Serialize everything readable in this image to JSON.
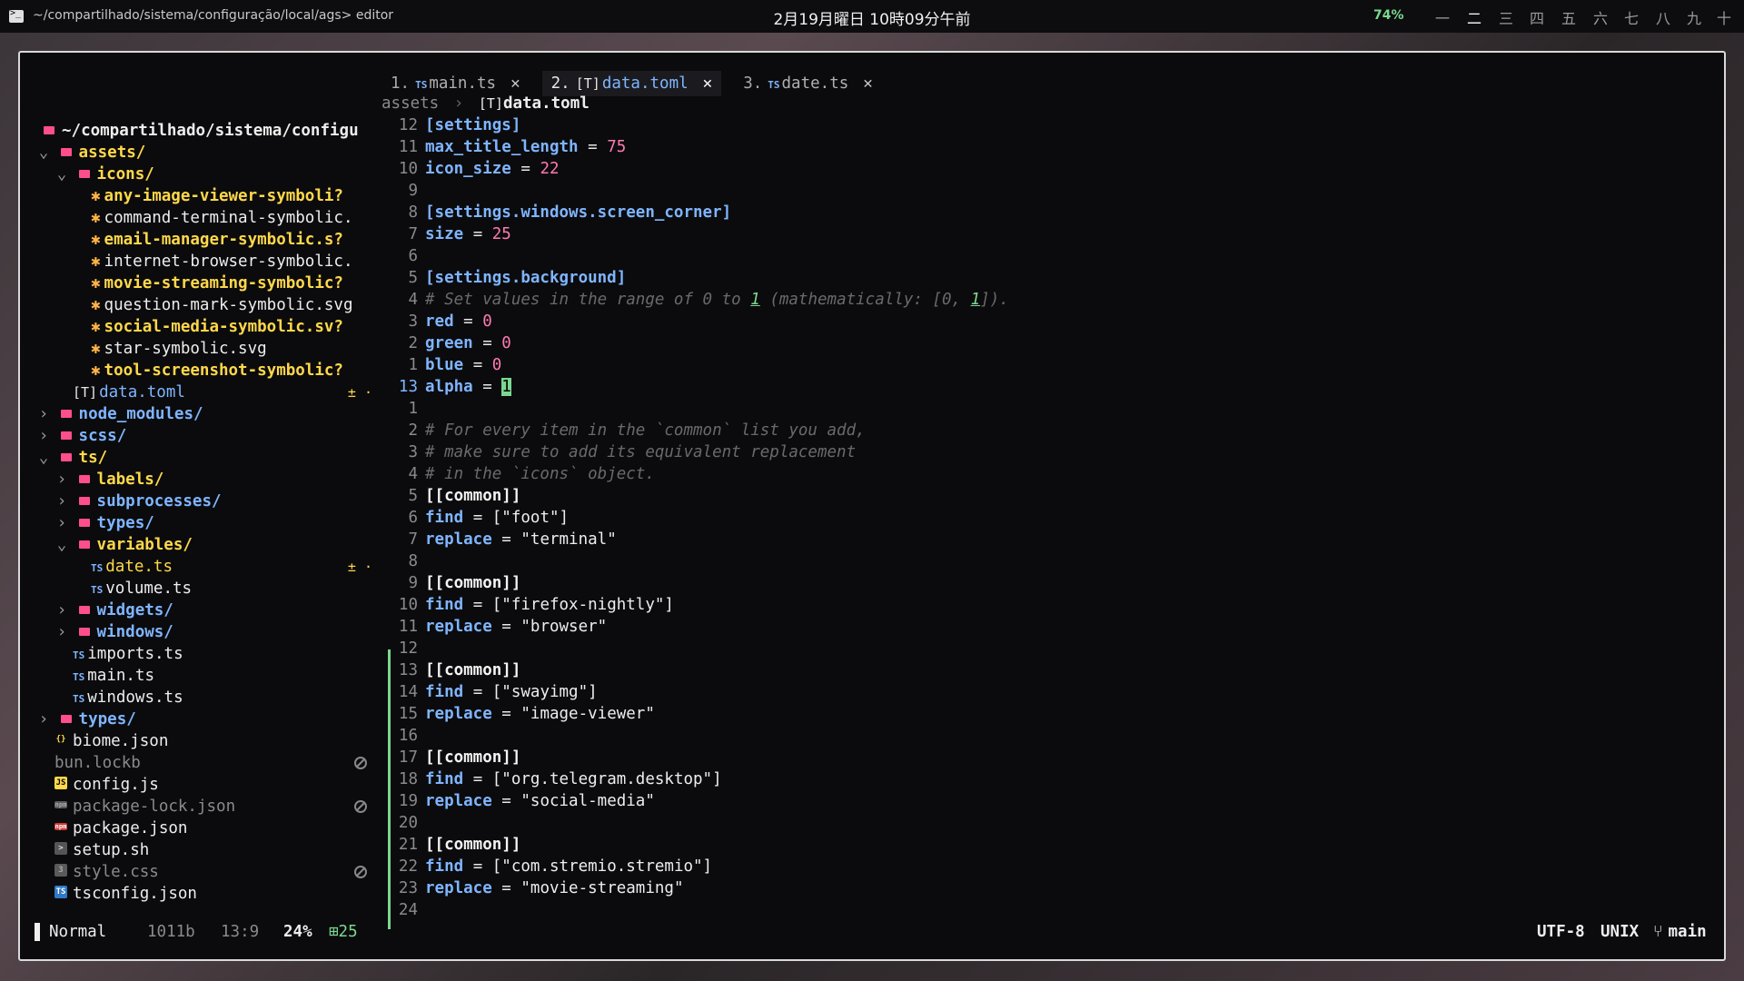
{
  "topbar": {
    "window_title": "~/compartilhado/sistema/configuração/local/ags> editor",
    "clock": "2月19月曜日 10時09分午前",
    "battery": "74%",
    "workspaces": [
      "一",
      "二",
      "三",
      "四",
      "五",
      "六",
      "七",
      "八",
      "九",
      "十"
    ]
  },
  "sidebar": {
    "root": "~/compartilhado/sistema/configu",
    "items": [
      {
        "label": "assets/",
        "kind": "dir"
      },
      {
        "label": "icons/",
        "kind": "dir"
      },
      {
        "label": "any-image-viewer-symboli?",
        "kind": "svg-mod"
      },
      {
        "label": "command-terminal-symbolic.",
        "kind": "svg"
      },
      {
        "label": "email-manager-symbolic.s?",
        "kind": "svg-mod"
      },
      {
        "label": "internet-browser-symbolic.",
        "kind": "svg"
      },
      {
        "label": "movie-streaming-symbolic?",
        "kind": "svg-mod"
      },
      {
        "label": "question-mark-symbolic.svg",
        "kind": "svg"
      },
      {
        "label": "social-media-symbolic.sv?",
        "kind": "svg-mod"
      },
      {
        "label": "star-symbolic.svg",
        "kind": "svg"
      },
      {
        "label": "tool-screenshot-symbolic?",
        "kind": "svg-mod"
      },
      {
        "label": "data.toml",
        "kind": "toml",
        "git": "± ·",
        "badge": "[T]"
      },
      {
        "label": "node_modules/",
        "kind": "dir-blue"
      },
      {
        "label": "scss/",
        "kind": "dir-blue"
      },
      {
        "label": "ts/",
        "kind": "dir"
      },
      {
        "label": "labels/",
        "kind": "dir-yellow"
      },
      {
        "label": "subprocesses/",
        "kind": "dir-blue"
      },
      {
        "label": "types/",
        "kind": "dir-blue"
      },
      {
        "label": "variables/",
        "kind": "dir-yellow"
      },
      {
        "label": "date.ts",
        "kind": "ts-mod",
        "git": "± ·"
      },
      {
        "label": "volume.ts",
        "kind": "ts"
      },
      {
        "label": "widgets/",
        "kind": "dir-blue"
      },
      {
        "label": "windows/",
        "kind": "dir-blue"
      },
      {
        "label": "imports.ts",
        "kind": "ts"
      },
      {
        "label": "main.ts",
        "kind": "ts"
      },
      {
        "label": "windows.ts",
        "kind": "ts"
      },
      {
        "label": "types/",
        "kind": "dir-blue"
      },
      {
        "label": "biome.json",
        "kind": "json"
      },
      {
        "label": "bun.lockb",
        "kind": "ignored"
      },
      {
        "label": "config.js",
        "kind": "js"
      },
      {
        "label": "package-lock.json",
        "kind": "ignored-npm"
      },
      {
        "label": "package.json",
        "kind": "npm"
      },
      {
        "label": "setup.sh",
        "kind": "sh"
      },
      {
        "label": "style.css",
        "kind": "ignored-css"
      },
      {
        "label": "tsconfig.json",
        "kind": "tsconfig"
      }
    ]
  },
  "tabs": [
    {
      "index": "1.",
      "badge": "TS",
      "name": "main.ts",
      "close": "✕"
    },
    {
      "index": "2.",
      "badge": "[T]",
      "name": "data.toml",
      "close": "✕"
    },
    {
      "index": "3.",
      "badge": "TS",
      "name": "date.ts",
      "close": "✕"
    }
  ],
  "breadcrumb": {
    "parent": "assets",
    "sep": "›",
    "badge": "[T]",
    "current": "data.toml"
  },
  "code": [
    {
      "ln": "12",
      "text": "[settings]"
    },
    {
      "ln": "11",
      "text": "max_title_length = 75"
    },
    {
      "ln": "10",
      "text": "icon_size = 22"
    },
    {
      "ln": "9",
      "text": ""
    },
    {
      "ln": "8",
      "text": "[settings.windows.screen_corner]"
    },
    {
      "ln": "7",
      "text": "size = 25"
    },
    {
      "ln": "6",
      "text": ""
    },
    {
      "ln": "5",
      "text": "[settings.background]"
    },
    {
      "ln": "4",
      "text": "# Set values in the range of 0 to 1 (mathematically: [0, 1])."
    },
    {
      "ln": "3",
      "text": "red = 0"
    },
    {
      "ln": "2",
      "text": "green = 0"
    },
    {
      "ln": "1",
      "text": "blue = 0"
    },
    {
      "ln": "13",
      "text": "alpha = 1"
    },
    {
      "ln": "1",
      "text": ""
    },
    {
      "ln": "2",
      "text": "# For every item in the `common` list you add,"
    },
    {
      "ln": "3",
      "text": "# make sure to add its equivalent replacement"
    },
    {
      "ln": "4",
      "text": "# in the `icons` object."
    },
    {
      "ln": "5",
      "text": "[[common]]"
    },
    {
      "ln": "6",
      "text": "find = [\"foot\"]"
    },
    {
      "ln": "7",
      "text": "replace = \"terminal\""
    },
    {
      "ln": "8",
      "text": ""
    },
    {
      "ln": "9",
      "text": "[[common]]"
    },
    {
      "ln": "10",
      "text": "find = [\"firefox-nightly\"]"
    },
    {
      "ln": "11",
      "text": "replace = \"browser\""
    },
    {
      "ln": "12",
      "text": ""
    },
    {
      "ln": "13",
      "text": "[[common]]"
    },
    {
      "ln": "14",
      "text": "find = [\"swayimg\"]"
    },
    {
      "ln": "15",
      "text": "replace = \"image-viewer\""
    },
    {
      "ln": "16",
      "text": ""
    },
    {
      "ln": "17",
      "text": "[[common]]"
    },
    {
      "ln": "18",
      "text": "find = [\"org.telegram.desktop\"]"
    },
    {
      "ln": "19",
      "text": "replace = \"social-media\""
    },
    {
      "ln": "20",
      "text": ""
    },
    {
      "ln": "21",
      "text": "[[common]]"
    },
    {
      "ln": "22",
      "text": "find = [\"com.stremio.stremio\"]"
    },
    {
      "ln": "23",
      "text": "replace = \"movie-streaming\""
    },
    {
      "ln": "24",
      "text": ""
    }
  ],
  "statusline": {
    "mode": "Normal",
    "size": "1011b",
    "position": "13:9",
    "percent": "24%",
    "added": "25",
    "encoding": "UTF-8",
    "eol": "UNIX",
    "branch": "main"
  },
  "colors": {
    "accent_blue": "#7fb5ff",
    "accent_green": "#7bd88f",
    "number_pink": "#ff7ab3",
    "folder_pink": "#ff4f8b",
    "dir_yellow": "#ffd84a"
  }
}
